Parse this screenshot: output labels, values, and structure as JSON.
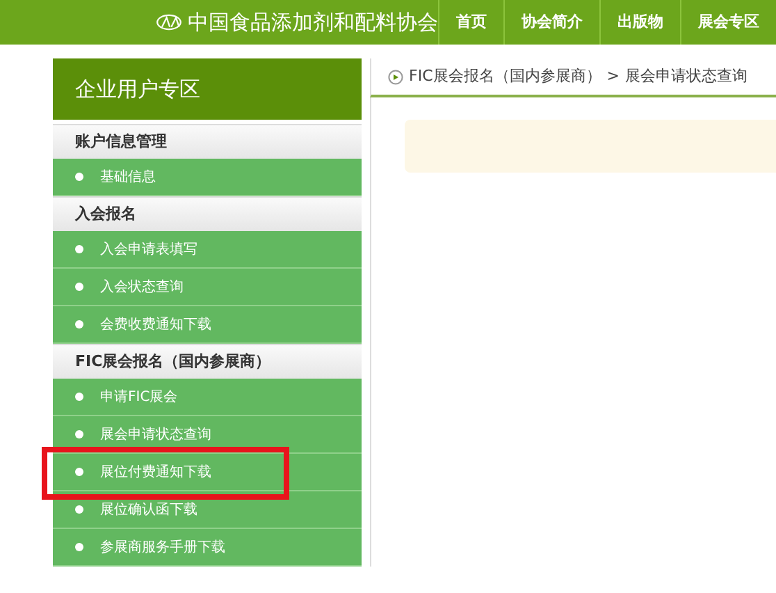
{
  "header": {
    "site_name": "中国食品添加剂和配料协会",
    "nav": [
      "首页",
      "协会简介",
      "出版物",
      "展会专区"
    ]
  },
  "sidebar": {
    "title": "企业用户专区",
    "sections": [
      {
        "title": "账户信息管理",
        "items": [
          {
            "label": "基础信息",
            "highlighted": false
          }
        ]
      },
      {
        "title": "入会报名",
        "items": [
          {
            "label": "入会申请表填写",
            "highlighted": false
          },
          {
            "label": "入会状态查询",
            "highlighted": false
          },
          {
            "label": "会费收费通知下载",
            "highlighted": false
          }
        ]
      },
      {
        "title": "FIC展会报名（国内参展商）",
        "items": [
          {
            "label": "申请FIC展会",
            "highlighted": false
          },
          {
            "label": "展会申请状态查询",
            "highlighted": false
          },
          {
            "label": "展位付费通知下载",
            "highlighted": true
          },
          {
            "label": "展位确认函下载",
            "highlighted": false
          },
          {
            "label": "参展商服务手册下载",
            "highlighted": false
          }
        ]
      }
    ]
  },
  "breadcrumb": {
    "parent": "FIC展会报名（国内参展商）",
    "separator": ">",
    "current": "展会申请状态查询"
  }
}
